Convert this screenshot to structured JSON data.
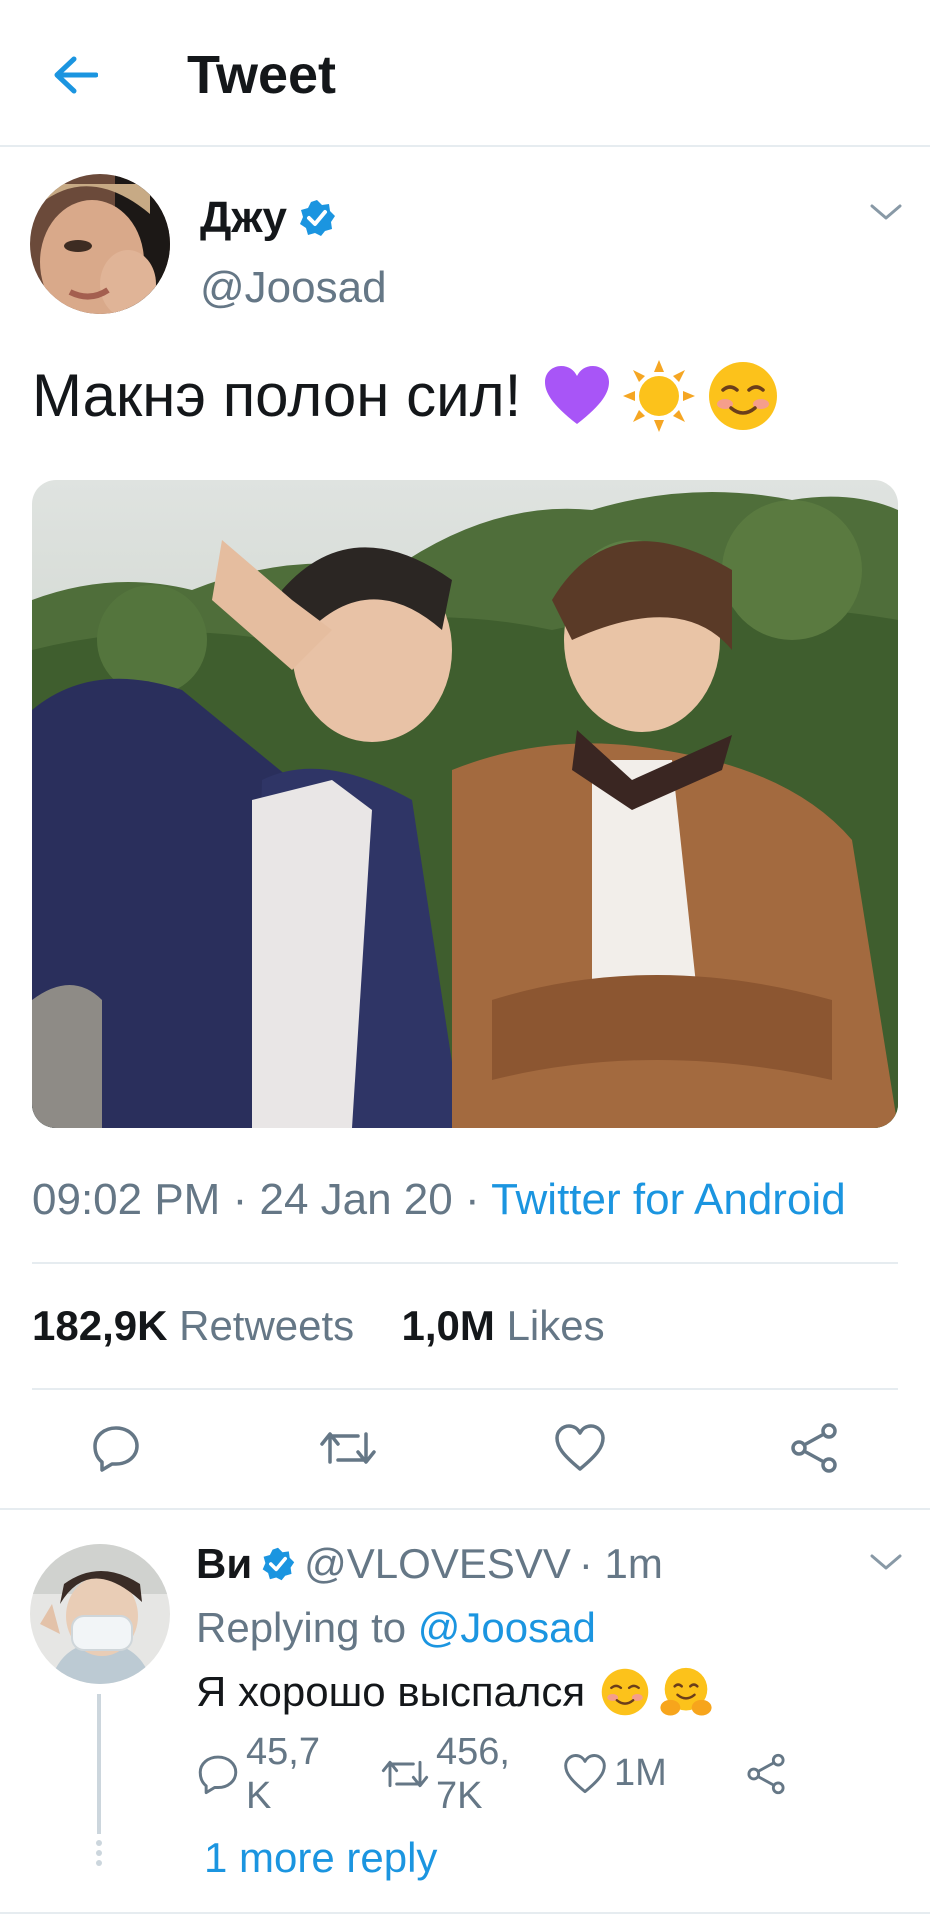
{
  "header": {
    "title": "Tweet"
  },
  "tweet": {
    "author_name": "Джу",
    "author_handle": "@Joosad",
    "text": "Макнэ полон сил!",
    "emojis": [
      "purple-heart",
      "sun",
      "smiling-face"
    ],
    "time": "09:02 PM",
    "date": "24 Jan 20",
    "separator": "·",
    "source": "Twitter for Android",
    "retweet_count": "182,9K",
    "retweet_label": "Retweets",
    "like_count": "1,0M",
    "like_label": "Likes"
  },
  "reply": {
    "author_name": "Ви",
    "author_handle": "@VLOVESVV",
    "time_ago": "· 1m",
    "replying_label": "Replying to",
    "replying_handle": "@Joosad",
    "text": "Я хорошо выспался",
    "emojis": [
      "smiling-face",
      "hugging-face"
    ],
    "reply_count": "45,7 K",
    "retweet_count": "456, 7K",
    "like_count": "1M",
    "more_replies": "1 more reply"
  },
  "colors": {
    "accent": "#1b95e0",
    "text": "#14171a",
    "muted": "#657786",
    "divider": "#e6ecf0"
  }
}
